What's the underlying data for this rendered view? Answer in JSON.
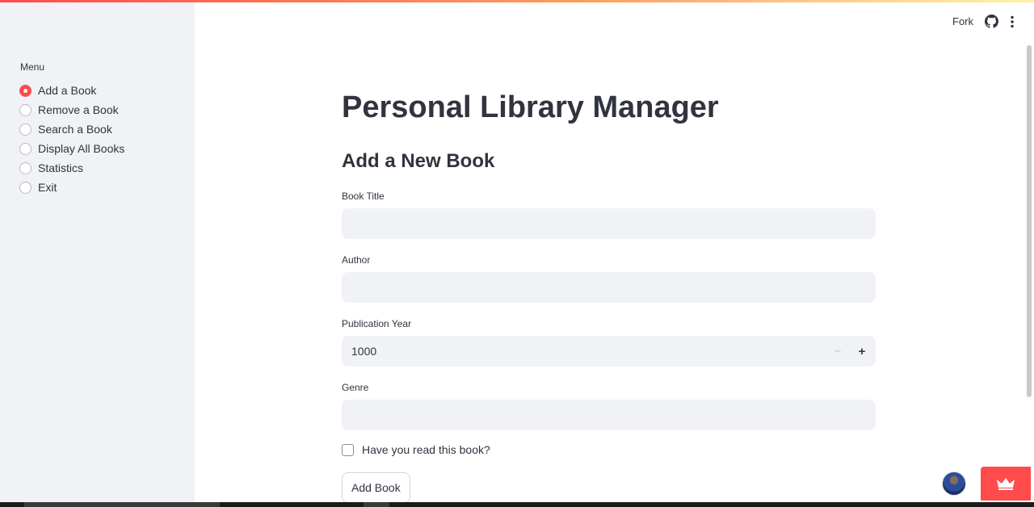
{
  "header": {
    "fork_label": "Fork",
    "github_icon": "github-icon",
    "more_icon": "more-vertical-icon"
  },
  "sidebar": {
    "menu_title": "Menu",
    "selected": "Add a Book",
    "items": [
      {
        "label": "Add a Book"
      },
      {
        "label": "Remove a Book"
      },
      {
        "label": "Search a Book"
      },
      {
        "label": "Display All Books"
      },
      {
        "label": "Statistics"
      },
      {
        "label": "Exit"
      }
    ],
    "accent_color": "#ff4b4b"
  },
  "main": {
    "title": "Personal Library Manager",
    "section_title": "Add a New Book",
    "fields": {
      "book_title": {
        "label": "Book Title",
        "value": ""
      },
      "author": {
        "label": "Author",
        "value": ""
      },
      "publication_year": {
        "label": "Publication Year",
        "value": "1000"
      },
      "genre": {
        "label": "Genre",
        "value": ""
      }
    },
    "read_checkbox": {
      "label": "Have you read this book?",
      "checked": false
    },
    "add_button_label": "Add Book"
  },
  "footer": {
    "avatar": "user-avatar",
    "deploy_icon": "crown-icon"
  }
}
